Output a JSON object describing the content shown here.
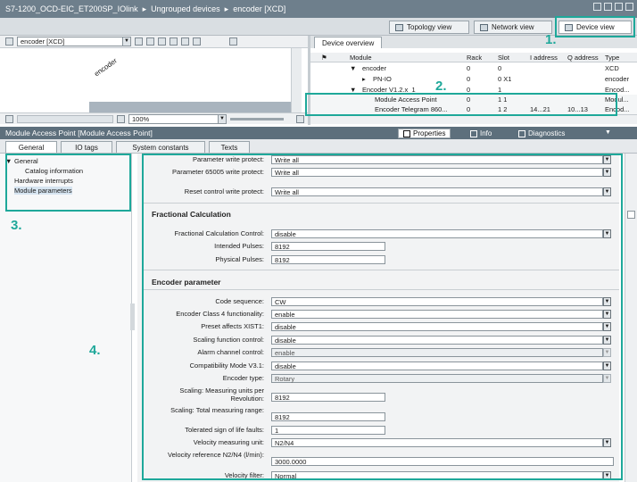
{
  "window": {
    "breadcrumb": [
      "S7-1200_OCD-EIC_ET200SP_IOlink",
      "Ungrouped devices",
      "encoder [XCD]"
    ],
    "sep": "▸"
  },
  "view_tabs": {
    "topology": "Topology view",
    "network": "Network view",
    "device": "Device view"
  },
  "device_toolbar": {
    "device_select": "encoder [XCD]",
    "zoom": "100%"
  },
  "canvas": {
    "device_label": "encoder"
  },
  "overview": {
    "tab": "Device overview",
    "columns": [
      "Module",
      "Rack",
      "Slot",
      "I address",
      "Q address",
      "Type"
    ],
    "rows": [
      {
        "module": "encoder",
        "rack": "0",
        "slot": "0",
        "iaddr": "",
        "qaddr": "",
        "type": "XCD"
      },
      {
        "module": "PN-IO",
        "rack": "0",
        "slot": "0 X1",
        "iaddr": "",
        "qaddr": "",
        "type": "encoder"
      },
      {
        "module": "Encoder V1.2.x_1",
        "rack": "0",
        "slot": "1",
        "iaddr": "",
        "qaddr": "",
        "type": "Encod..."
      },
      {
        "module": "Module Access Point",
        "rack": "0",
        "slot": "1 1",
        "iaddr": "",
        "qaddr": "",
        "type": "Modul..."
      },
      {
        "module": "Encoder Telegram 860...",
        "rack": "0",
        "slot": "1 2",
        "iaddr": "14...21",
        "qaddr": "10...13",
        "type": "Encod..."
      }
    ]
  },
  "inspector": {
    "title": "Module Access Point [Module Access Point]",
    "properties": "Properties",
    "info": "Info",
    "diagnostics": "Diagnostics"
  },
  "sub_tabs": {
    "general": "General",
    "io_tags": "IO tags",
    "system_constants": "System constants",
    "texts": "Texts"
  },
  "nav": {
    "general": "General",
    "catalog_information": "Catalog information",
    "hardware_interrupts": "Hardware interrupts",
    "module_parameters": "Module parameters"
  },
  "params_top": [
    {
      "label": "Parameter write protect:",
      "value": "Write all"
    },
    {
      "label": "Parameter 65005 write protect:",
      "value": "Write all"
    },
    {
      "label": "Reset control write protect:",
      "value": "Write all"
    }
  ],
  "fractional": {
    "heading": "Fractional Calculation",
    "control_label": "Fractional Calculation Control:",
    "control_value": "disable",
    "intended_label": "Intended Pulses:",
    "intended_value": "8192",
    "physical_label": "Physical Pulses:",
    "physical_value": "8192"
  },
  "encoder_param": {
    "heading": "Encoder parameter",
    "items": [
      {
        "label": "Code sequence:",
        "value": "CW"
      },
      {
        "label": "Encoder Class 4 functionality:",
        "value": "enable"
      },
      {
        "label": "Preset affects XIST1:",
        "value": "disable"
      },
      {
        "label": "Scaling function control:",
        "value": "disable"
      },
      {
        "label": "Alarm channel control:",
        "value": "enable"
      },
      {
        "label": "Compatibility Mode V3.1:",
        "value": "disable"
      },
      {
        "label": "Encoder type:",
        "value": "Rotary"
      },
      {
        "label": "Scaling: Measuring units per Revolution:",
        "value": "8192"
      },
      {
        "label": "Scaling: Total measuring range:",
        "value": "8192"
      },
      {
        "label": "Tolerated sign of life faults:",
        "value": "1"
      },
      {
        "label": "Velocity measuring unit:",
        "value": "N2/N4"
      },
      {
        "label": "Velocity reference N2/N4 (l/min):",
        "value": "3000.0000"
      },
      {
        "label": "Velocity filter:",
        "value": "Normal"
      }
    ]
  },
  "callouts": [
    "1.",
    "2.",
    "3.",
    "4."
  ],
  "colors": {
    "callout": "#1ea89a",
    "titlebar": "#6e7f8c",
    "inspector": "#5d6f7c"
  }
}
